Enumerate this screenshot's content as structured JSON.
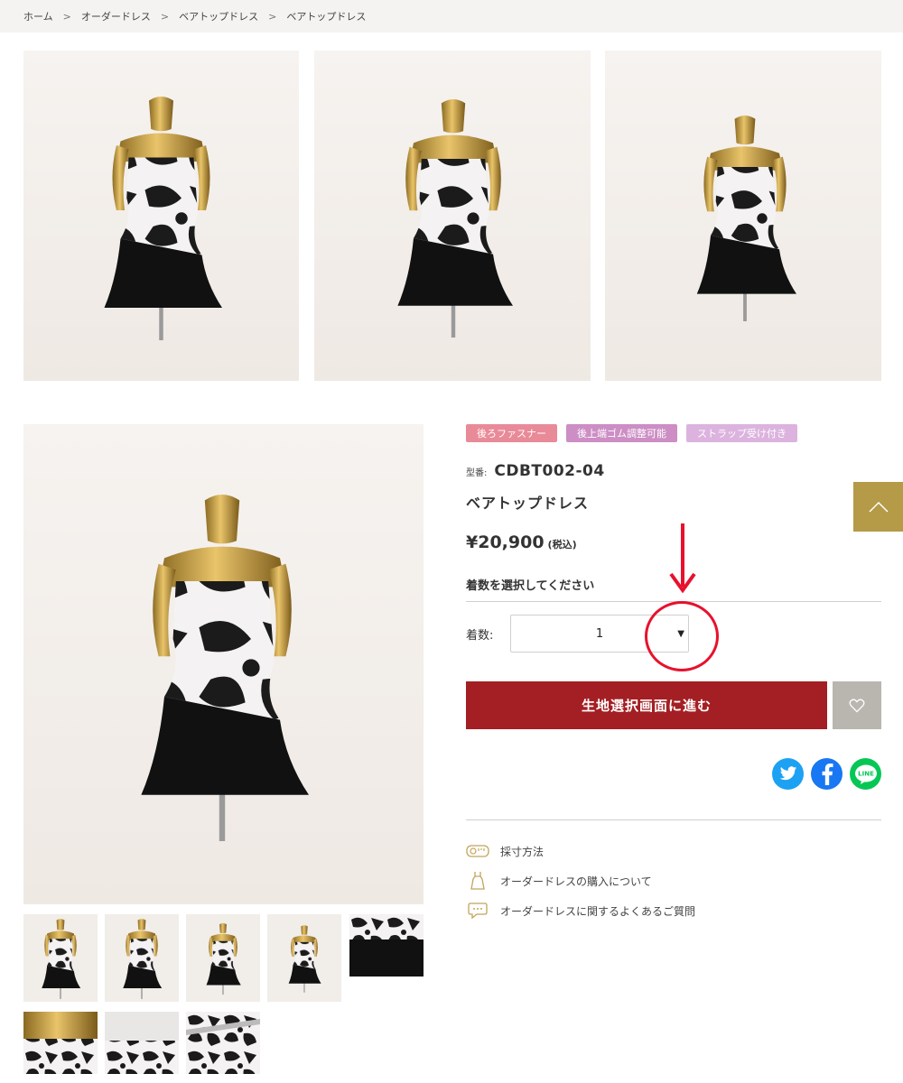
{
  "breadcrumb": {
    "items": [
      "ホーム",
      "オーダードレス",
      "ベアトップドレス",
      "ベアトップドレス"
    ],
    "separator": ">"
  },
  "gallery": {
    "top_images": [
      "dress-front",
      "dress-front-angle",
      "dress-side"
    ],
    "main_image": "dress-front",
    "thumbnails": [
      "dress-front",
      "dress-front-angle",
      "dress-side-angle",
      "dress-side",
      "fabric-closeup",
      "bodice-top",
      "fabric-detail",
      "fabric-pattern"
    ]
  },
  "product": {
    "tags": [
      "後ろファスナー",
      "後上端ゴム調整可能",
      "ストラップ受け付き"
    ],
    "model_label": "型番:",
    "model_number": "CDBT002-04",
    "name": "ベアトップドレス",
    "price": "¥20,900",
    "tax_note": "(税込)"
  },
  "quantity": {
    "heading": "着数を選択してください",
    "label": "着数:",
    "value": "1",
    "caret": "▼"
  },
  "actions": {
    "cta_label": "生地選択画面に進む",
    "favorite_icon": "heart-icon",
    "scroll_top_icon": "chevron-up-icon"
  },
  "share": {
    "icons": [
      "twitter-icon",
      "facebook-icon",
      "line-icon"
    ],
    "line_text": "LINE"
  },
  "info_links": [
    {
      "icon": "measuring-tape-icon",
      "label": "採寸方法"
    },
    {
      "icon": "dress-icon",
      "label": "オーダードレスの購入について"
    },
    {
      "icon": "faq-chat-icon",
      "label": "オーダードレスに関するよくあるご質問"
    }
  ],
  "colors": {
    "cta": "#a31f24",
    "scroll_top": "#b59a47",
    "annotation": "#e8112d",
    "tag_1": "#e98a98",
    "tag_2": "#cc8ec4",
    "tag_3": "#dcb3de"
  }
}
